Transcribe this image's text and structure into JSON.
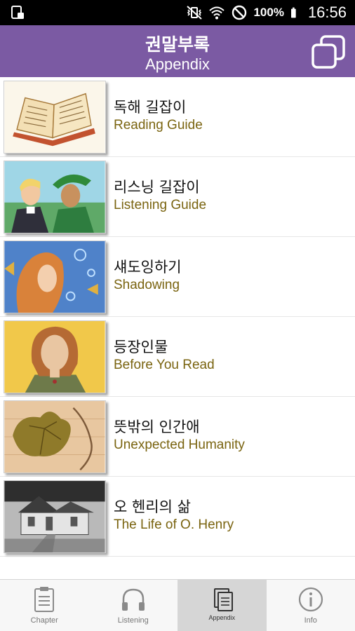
{
  "status_bar": {
    "battery_text": "100%",
    "time": "16:56",
    "icons": [
      "screenshot-icon",
      "vibrate-icon",
      "wifi-icon",
      "do-not-disturb-icon",
      "battery-icon"
    ]
  },
  "header": {
    "title_ko": "권말부록",
    "title_en": "Appendix",
    "background": "#7b5aa3"
  },
  "items": [
    {
      "ko": "독해 길잡이",
      "en": "Reading Guide",
      "thumb": "open-book-illustration"
    },
    {
      "ko": "리스닝 길잡이",
      "en": "Listening Guide",
      "thumb": "two-men-illustration"
    },
    {
      "ko": "섀도잉하기",
      "en": "Shadowing",
      "thumb": "girl-underwater-illustration"
    },
    {
      "ko": "등장인물",
      "en": "Before You Read",
      "thumb": "woman-portrait-illustration"
    },
    {
      "ko": "뜻밖의 인간애",
      "en": "Unexpected Humanity",
      "thumb": "ivy-leaf-illustration"
    },
    {
      "ko": "오 헨리의 삶",
      "en": "The Life of O. Henry",
      "thumb": "house-photo"
    }
  ],
  "nav": {
    "tabs": [
      {
        "label": "Chapter",
        "icon": "clipboard-icon",
        "active": false
      },
      {
        "label": "Listening",
        "icon": "headphones-icon",
        "active": false
      },
      {
        "label": "Appendix",
        "icon": "documents-icon",
        "active": true
      },
      {
        "label": "Info",
        "icon": "info-icon",
        "active": false
      }
    ]
  },
  "colors": {
    "accent": "#7b5aa3",
    "english_text": "#7a6410"
  }
}
